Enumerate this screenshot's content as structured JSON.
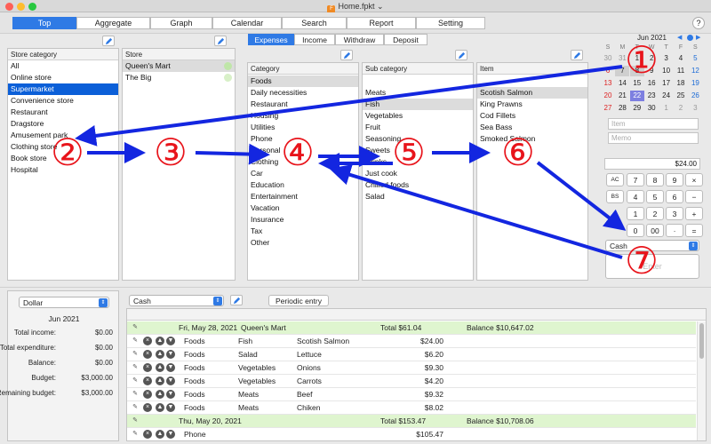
{
  "window": {
    "title": "Home.fpkt",
    "file_icon": "app-file-icon"
  },
  "tabs": [
    {
      "label": "Top",
      "selected": true
    },
    {
      "label": "Aggregate",
      "selected": false
    },
    {
      "label": "Graph",
      "selected": false
    },
    {
      "label": "Calendar",
      "selected": false
    },
    {
      "label": "Search",
      "selected": false
    },
    {
      "label": "Report",
      "selected": false
    },
    {
      "label": "Setting",
      "selected": false
    }
  ],
  "help_label": "?",
  "store_category": {
    "header": "Store category",
    "items": [
      {
        "label": "All"
      },
      {
        "label": "Online store"
      },
      {
        "label": "Supermarket",
        "selected": true
      },
      {
        "label": "Convenience store"
      },
      {
        "label": "Restaurant"
      },
      {
        "label": "Dragstore"
      },
      {
        "label": "Amusement park"
      },
      {
        "label": "Clothing store"
      },
      {
        "label": "Book store"
      },
      {
        "label": "Hospital"
      }
    ]
  },
  "store": {
    "header": "Store",
    "items": [
      {
        "label": "Queen's Mart",
        "selected": true
      },
      {
        "label": "The Big"
      }
    ]
  },
  "entry_types": [
    {
      "label": "Expenses",
      "selected": true
    },
    {
      "label": "Income"
    },
    {
      "label": "Withdraw"
    },
    {
      "label": "Deposit"
    }
  ],
  "category": {
    "header": "Category",
    "items": [
      "Foods",
      "Daily necessities",
      "Restaurant",
      "Housing",
      "Utilities",
      "Phone",
      "Personal",
      "Clothing",
      "Car",
      "Education",
      "Entertainment",
      "Vacation",
      "Insurance",
      "Tax",
      "Other"
    ]
  },
  "subcategory": {
    "header": "Sub category",
    "items": [
      "Meats",
      "Fish",
      "Vegetables",
      "Fruit",
      "Seasoning",
      "Sweets",
      "Drinks",
      "Just cook",
      "Chilled foods",
      "Salad"
    ]
  },
  "item": {
    "header": "Item",
    "items": [
      "Scotish Salmon",
      "King Prawns",
      "Cod Fillets",
      "Sea Bass",
      "Smoked Salmon"
    ]
  },
  "calendar": {
    "month_label": "Jun 2021",
    "weekdays": [
      "S",
      "M",
      "T",
      "W",
      "T",
      "F",
      "S"
    ],
    "weeks": [
      [
        "30",
        "31",
        "1",
        "2",
        "3",
        "4",
        "5"
      ],
      [
        "6",
        "7",
        "8",
        "9",
        "10",
        "11",
        "12"
      ],
      [
        "13",
        "14",
        "15",
        "16",
        "17",
        "18",
        "19"
      ],
      [
        "20",
        "21",
        "22",
        "23",
        "24",
        "25",
        "26"
      ],
      [
        "27",
        "28",
        "29",
        "30",
        "1",
        "2",
        "3"
      ]
    ],
    "today": "22"
  },
  "entry_form": {
    "item_placeholder": "Item",
    "memo_placeholder": "Memo",
    "amount": "$24.00",
    "keys": [
      [
        "AC",
        "7",
        "8",
        "9",
        "×"
      ],
      [
        "BS",
        "4",
        "5",
        "6",
        "−"
      ],
      [
        "",
        "1",
        "2",
        "3",
        "+"
      ],
      [
        "",
        "0",
        "00",
        "·",
        "="
      ]
    ],
    "payment": "Cash",
    "enter_label": "Enter"
  },
  "summary": {
    "currency": "Dollar",
    "period": "Jun 2021",
    "rows": [
      {
        "label": "Total income:",
        "value": "$0.00"
      },
      {
        "label": "Total expenditure:",
        "value": "$0.00"
      },
      {
        "label": "Balance:",
        "value": "$0.00"
      },
      {
        "label": "Budget:",
        "value": "$3,000.00"
      },
      {
        "label": "Remaining budget:",
        "value": "$3,000.00"
      }
    ]
  },
  "journal": {
    "account": "Cash",
    "periodic_label": "Periodic entry",
    "groups": [
      {
        "date": "Fri, May 28, 2021",
        "store": "Queen's Mart",
        "total": "Total $61.04",
        "balance": "Balance $10,647.02",
        "rows": [
          {
            "cat": "Foods",
            "sub": "Fish",
            "item": "Scotish Salmon",
            "amount": "$24.00"
          },
          {
            "cat": "Foods",
            "sub": "Salad",
            "item": "Lettuce",
            "amount": "$6.20"
          },
          {
            "cat": "Foods",
            "sub": "Vegetables",
            "item": "Onions",
            "amount": "$9.30"
          },
          {
            "cat": "Foods",
            "sub": "Vegetables",
            "item": "Carrots",
            "amount": "$4.20"
          },
          {
            "cat": "Foods",
            "sub": "Meats",
            "item": "Beef",
            "amount": "$9.32"
          },
          {
            "cat": "Foods",
            "sub": "Meats",
            "item": "Chiken",
            "amount": "$8.02"
          }
        ]
      },
      {
        "date": "Thu, May 20, 2021",
        "store": "",
        "total": "Total $153.47",
        "balance": "Balance $10,708.06",
        "rows": [
          {
            "cat": "Phone",
            "sub": "",
            "item": "",
            "amount": "$105.47"
          }
        ]
      }
    ]
  },
  "annotations": [
    "①",
    "②",
    "③",
    "④",
    "⑤",
    "⑥",
    "⑦"
  ],
  "colors": {
    "accent": "#2f7ae5",
    "selection": "#0b5fd8",
    "annotation_red": "#e8141b",
    "arrow_blue": "#1326e0",
    "date_row": "#dff5cf"
  }
}
